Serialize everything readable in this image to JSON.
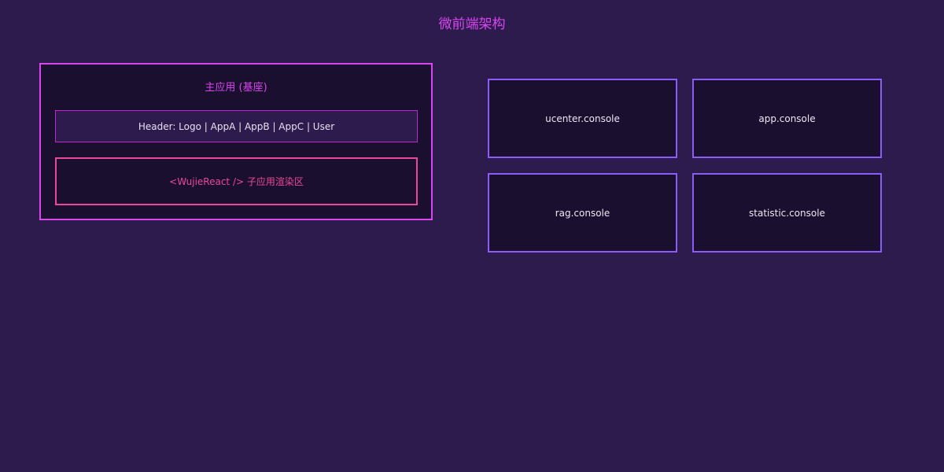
{
  "diagram": {
    "title": "微前端架构",
    "host_app": {
      "title": "主应用 (基座)",
      "header_text": "Header: Logo | AppA | AppB | AppC | User",
      "render_area_text": "<WujieReact /> 子应用渲染区"
    },
    "sub_apps": [
      "ucenter.console",
      "app.console",
      "rag.console",
      "statistic.console"
    ]
  },
  "colors": {
    "background": "#2d1b4e",
    "host_border": "#d946ef",
    "render_area_border": "#ec4899",
    "sub_app_border": "#8b5cf6",
    "box_fill": "#1a0f2e"
  }
}
